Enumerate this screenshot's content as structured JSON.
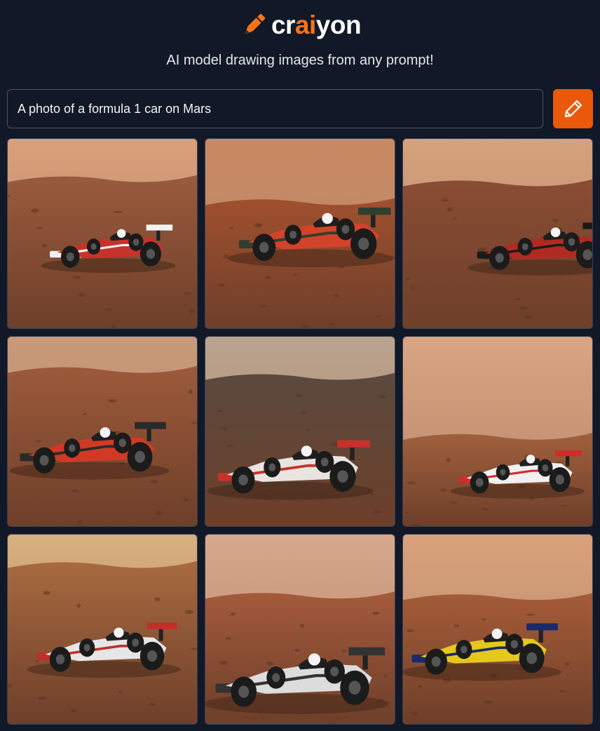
{
  "app": {
    "logo_text_pre": "cr",
    "logo_text_accent": "ai",
    "logo_text_post": "yon",
    "logo_icon": "crayon-pencil-icon",
    "tagline": "AI model drawing images from any prompt!"
  },
  "search": {
    "value": "A photo of a formula 1 car on Mars",
    "button_icon": "pencil-icon"
  },
  "colors": {
    "background": "#111827",
    "accent": "#f97316",
    "button": "#ea580c"
  },
  "results": [
    {
      "id": 1,
      "car_color": "#c8322c",
      "accent_color": "#f2f2f2",
      "sky": "#d9a07a",
      "ground": "#9a5b3c"
    },
    {
      "id": 2,
      "car_color": "#d2432a",
      "accent_color": "#2f3f2f",
      "sky": "#c98a63",
      "ground": "#a0502e"
    },
    {
      "id": 3,
      "car_color": "#b02a22",
      "accent_color": "#1a1a1a",
      "sky": "#d6a27d",
      "ground": "#8a4d34"
    },
    {
      "id": 4,
      "car_color": "#d03a25",
      "accent_color": "#2a2a2a",
      "sky": "#c99a7a",
      "ground": "#9c5a3a"
    },
    {
      "id": 5,
      "car_color": "#e8e4e0",
      "accent_color": "#c7322a",
      "sky": "#b9a48f",
      "ground": "#5a4a3e"
    },
    {
      "id": 6,
      "car_color": "#f0f0f0",
      "accent_color": "#d42a2a",
      "sky": "#d9a583",
      "ground": "#a0603d"
    },
    {
      "id": 7,
      "car_color": "#e6e6e6",
      "accent_color": "#c0302a",
      "sky": "#d8b07f",
      "ground": "#a86a40"
    },
    {
      "id": 8,
      "car_color": "#dcdcdc",
      "accent_color": "#333333",
      "sky": "#d8a88c",
      "ground": "#a45a3c"
    },
    {
      "id": 9,
      "car_color": "#e4c81e",
      "accent_color": "#1a2a6a",
      "sky": "#d9a27c",
      "ground": "#a55c38"
    }
  ]
}
